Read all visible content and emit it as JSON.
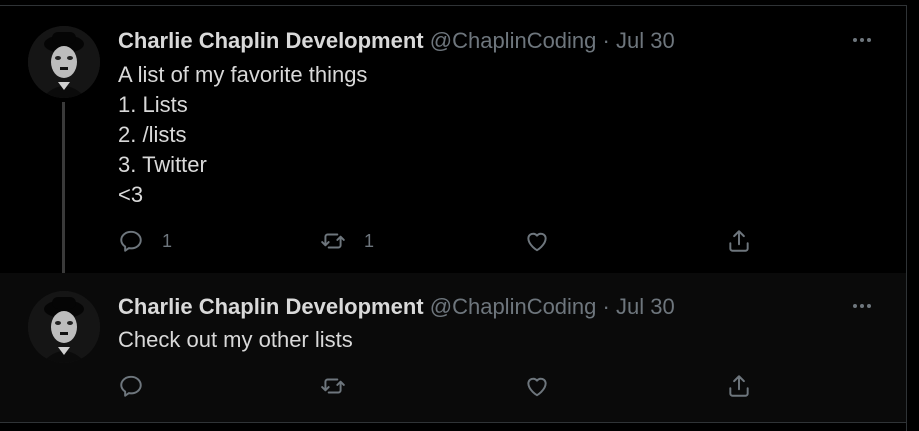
{
  "tweets": [
    {
      "author_name": "Charlie Chaplin Development",
      "handle": "@ChaplinCoding",
      "separator": "·",
      "date": "Jul 30",
      "lines": [
        "A list of my favorite things",
        "1. Lists",
        "2. /lists",
        "3. Twitter",
        "<3"
      ],
      "reply_count": "1",
      "retweet_count": "1",
      "like_count": "",
      "icons": {
        "reply": "reply-icon",
        "retweet": "retweet-icon",
        "like": "heart-icon",
        "share": "share-icon",
        "more": "more-icon"
      }
    },
    {
      "author_name": "Charlie Chaplin Development",
      "handle": "@ChaplinCoding",
      "separator": "·",
      "date": "Jul 30",
      "lines": [
        "Check out my other lists"
      ],
      "reply_count": "",
      "retweet_count": "",
      "like_count": "",
      "icons": {
        "reply": "reply-icon",
        "retweet": "retweet-icon",
        "like": "heart-icon",
        "share": "share-icon",
        "more": "more-icon"
      }
    }
  ],
  "colors": {
    "background": "#000000",
    "secondary": "#6e767d",
    "text": "#d9d9d9",
    "border": "#2f3336"
  }
}
